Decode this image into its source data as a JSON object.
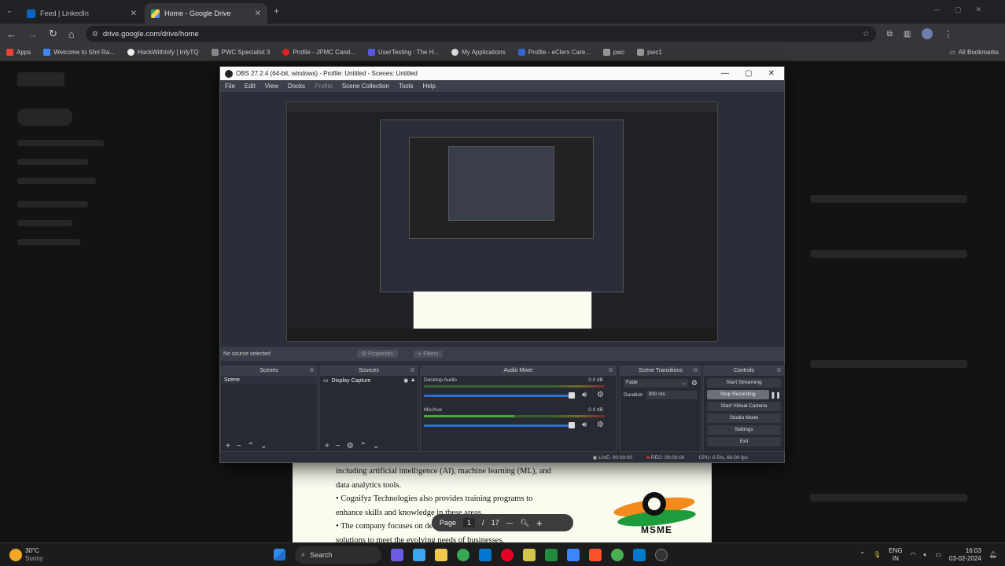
{
  "browser": {
    "tabs": [
      {
        "label": "Feed | LinkedIn",
        "active": false
      },
      {
        "label": "Home - Google Drive",
        "active": true
      }
    ],
    "new_tab": "+",
    "url": "drive.google.com/drive/home",
    "bookmarks": [
      "Apps",
      "Welcome to Shri Ra...",
      "HackWithInfy | InfyTQ",
      "PWC Specialist 3",
      "Profile - JPMC Cand...",
      "UserTesting : The H...",
      "My Applications",
      "Profile - eClerx Care...",
      "pwc",
      "pwc1"
    ],
    "all_bookmarks": "All Bookmarks"
  },
  "obs": {
    "title": "OBS 27.2.4 (64-bit, windows) - Profile: Untitled - Scenes: Untitled",
    "menu": [
      "File",
      "Edit",
      "View",
      "Docks",
      "Profile",
      "Scene Collection",
      "Tools",
      "Help"
    ],
    "no_source": "No source selected",
    "properties_label": "Properties",
    "filters_label": "Filters",
    "docks": {
      "scenes": {
        "title": "Scenes",
        "items": [
          "Scene"
        ]
      },
      "sources": {
        "title": "Sources",
        "items": [
          "Display Capture"
        ]
      },
      "mixer": {
        "title": "Audio Mixer",
        "channels": [
          {
            "name": "Desktop Audio",
            "level": "0.0 dB"
          },
          {
            "name": "Mic/Aux",
            "level": "0.0 dB"
          }
        ]
      },
      "transitions": {
        "title": "Scene Transitions",
        "transition": "Fade",
        "duration_label": "Duration",
        "duration": "300 ms"
      },
      "controls": {
        "title": "Controls",
        "buttons": [
          "Start Streaming",
          "Stop Recording",
          "Start Virtual Camera",
          "Studio Mode",
          "Settings",
          "Exit"
        ]
      }
    },
    "status": {
      "live": "LIVE: 00:00:00",
      "rec": "REC: 00:00:00",
      "cpu": "CPU: 0.5%, 60.00 fps"
    }
  },
  "pdf": {
    "lines": [
      "including artificial intelligence (AI), machine learning (ML), and",
      "data analytics tools.",
      "Cognifyz Technologies also provides training programs to",
      "enhance skills and knowledge in these areas.",
      "The company focuses on delivering cutting-edge",
      "solutions to meet the evolving needs of businesses."
    ],
    "page_label": "Page",
    "page": "1",
    "sep": "/",
    "total": "17",
    "logo_text": "MSME"
  },
  "taskbar": {
    "weather_temp": "30°C",
    "weather_desc": "Sunny",
    "search": "Search",
    "lang": "ENG",
    "region": "IN",
    "time": "16:03",
    "date": "03-02-2024"
  },
  "colors": {
    "accent": "#2f6fd3",
    "chrome_dark": "#202124",
    "obs_bg": "#2b2e38"
  }
}
